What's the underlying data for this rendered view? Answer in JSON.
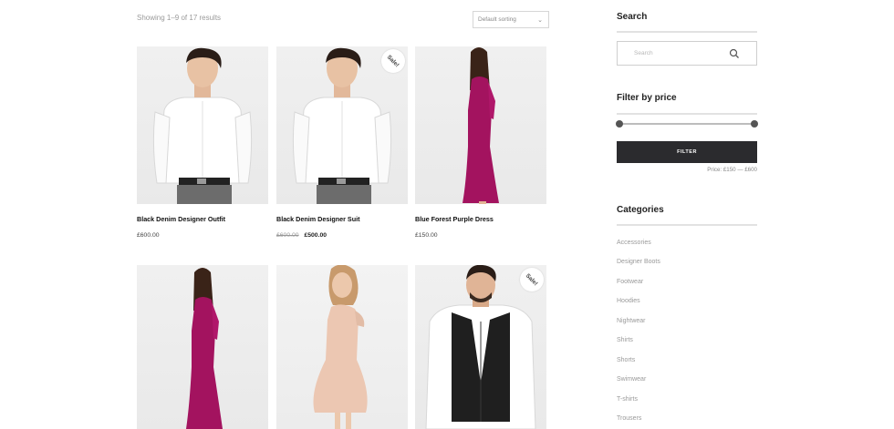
{
  "shop": {
    "results_text": "Showing 1–9 of 17 results",
    "sorting": {
      "selected": "Default sorting"
    }
  },
  "products": [
    {
      "title": "Black Denim Designer Outfit",
      "price": "£600.00",
      "sale": false,
      "image": "man-white-shirt"
    },
    {
      "title": "Black Denim Designer Suit",
      "old_price": "£600.00",
      "price": "£500.00",
      "sale": true,
      "sale_label": "Sale!",
      "image": "man-white-shirt"
    },
    {
      "title": "Blue Forest Purple Dress",
      "price": "£150.00",
      "sale": false,
      "image": "woman-purple-dress"
    },
    {
      "image": "woman-purple-dress",
      "sale": false
    },
    {
      "image": "woman-peach-dress",
      "sale": false
    },
    {
      "image": "man-black-vest",
      "sale": true,
      "sale_label": "Sale!"
    }
  ],
  "sidebar": {
    "search": {
      "title": "Search",
      "placeholder": "Search",
      "icon": "search-icon"
    },
    "price_filter": {
      "title": "Filter by price",
      "button_label": "FILTER",
      "range_text": "Price: £150 — £600",
      "min": 150,
      "max": 600
    },
    "categories": {
      "title": "Categories",
      "items": [
        "Accessories",
        "Designer Boots",
        "Footwear",
        "Hoodies",
        "Nightwear",
        "Shirts",
        "Shorts",
        "Swimwear",
        "T-shirts",
        "Trousers"
      ]
    }
  },
  "colors": {
    "accent_dark": "#2b2b2e",
    "dress_magenta": "#a3135f",
    "dress_peach": "#ecc7b2"
  }
}
